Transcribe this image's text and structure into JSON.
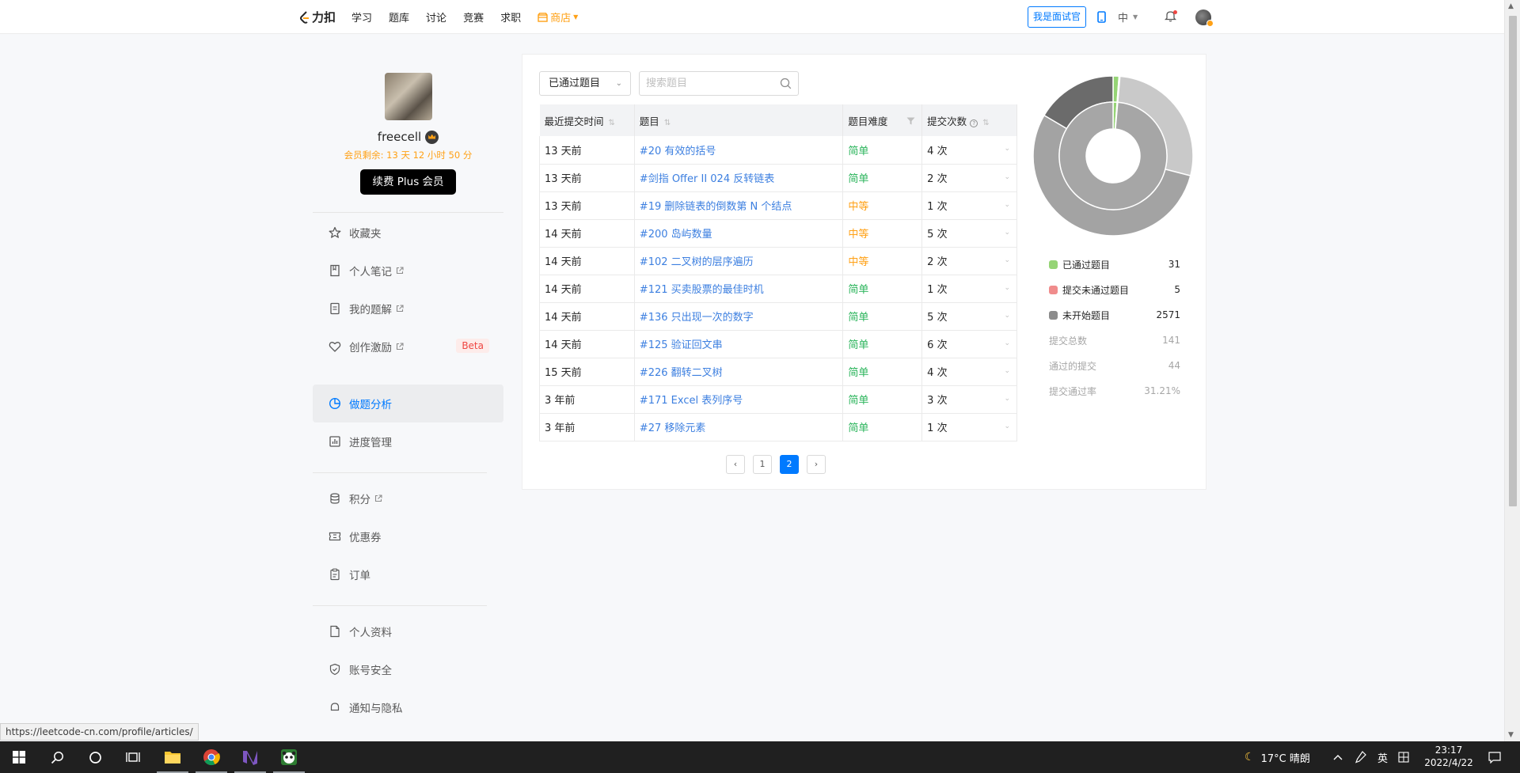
{
  "nav": {
    "logo_text": "力扣",
    "links": [
      "学习",
      "题库",
      "讨论",
      "竞赛",
      "求职"
    ],
    "store_label": "商店",
    "interviewer_button": "我是面试官",
    "lang_label": "中"
  },
  "profile": {
    "username": "freecell",
    "member_remaining": "会员剩余: 13 天 12 小时 50 分",
    "renew_button": "续费 Plus 会员"
  },
  "sidebar": {
    "group1": [
      {
        "label": "收藏夹",
        "icon": "star-icon"
      },
      {
        "label": "个人笔记",
        "icon": "notebook-icon",
        "external": true
      },
      {
        "label": "我的题解",
        "icon": "document-icon",
        "external": true
      },
      {
        "label": "创作激励",
        "icon": "heart-icon",
        "external": true,
        "badge": "Beta"
      }
    ],
    "group2": [
      {
        "label": "做题分析",
        "icon": "pie-chart-icon",
        "active": true
      },
      {
        "label": "进度管理",
        "icon": "bar-chart-icon"
      }
    ],
    "group3": [
      {
        "label": "积分",
        "icon": "coins-icon",
        "external": true
      },
      {
        "label": "优惠券",
        "icon": "coupon-icon"
      },
      {
        "label": "订单",
        "icon": "clipboard-icon"
      }
    ],
    "group4": [
      {
        "label": "个人资料",
        "icon": "file-icon"
      },
      {
        "label": "账号安全",
        "icon": "shield-icon"
      },
      {
        "label": "通知与隐私",
        "icon": "bell-icon"
      }
    ]
  },
  "filters": {
    "status_select": "已通过题目",
    "search_placeholder": "搜索题目"
  },
  "table": {
    "headers": [
      "最近提交时间",
      "题目",
      "题目难度",
      "提交次数"
    ],
    "rows": [
      {
        "time": "13 天前",
        "title": "#20 有效的括号",
        "difficulty": "简单",
        "level": "easy",
        "count": "4 次"
      },
      {
        "time": "13 天前",
        "title": "#剑指 Offer II 024 反转链表",
        "difficulty": "简单",
        "level": "easy",
        "count": "2 次"
      },
      {
        "time": "13 天前",
        "title": "#19 删除链表的倒数第 N 个结点",
        "difficulty": "中等",
        "level": "medium",
        "count": "1 次"
      },
      {
        "time": "14 天前",
        "title": "#200 岛屿数量",
        "difficulty": "中等",
        "level": "medium",
        "count": "5 次"
      },
      {
        "time": "14 天前",
        "title": "#102 二叉树的层序遍历",
        "difficulty": "中等",
        "level": "medium",
        "count": "2 次"
      },
      {
        "time": "14 天前",
        "title": "#121 买卖股票的最佳时机",
        "difficulty": "简单",
        "level": "easy",
        "count": "1 次"
      },
      {
        "time": "14 天前",
        "title": "#136 只出现一次的数字",
        "difficulty": "简单",
        "level": "easy",
        "count": "5 次"
      },
      {
        "time": "14 天前",
        "title": "#125 验证回文串",
        "difficulty": "简单",
        "level": "easy",
        "count": "6 次"
      },
      {
        "time": "15 天前",
        "title": "#226 翻转二叉树",
        "difficulty": "简单",
        "level": "easy",
        "count": "4 次"
      },
      {
        "time": "3 年前",
        "title": "#171 Excel 表列序号",
        "difficulty": "简单",
        "level": "easy",
        "count": "3 次"
      },
      {
        "time": "3 年前",
        "title": "#27 移除元素",
        "difficulty": "简单",
        "level": "easy",
        "count": "1 次"
      }
    ]
  },
  "pagination": {
    "pages": [
      "1",
      "2"
    ],
    "current": "2"
  },
  "stats": {
    "legend": [
      {
        "label": "已通过题目",
        "value": "31",
        "color": "#95d475"
      },
      {
        "label": "提交未通过题目",
        "value": "5",
        "color": "#f08c8c"
      },
      {
        "label": "未开始题目",
        "value": "2571",
        "color": "#8c8c8c"
      }
    ],
    "extra": [
      {
        "label": "提交总数",
        "value": "141"
      },
      {
        "label": "通过的提交",
        "value": "44"
      },
      {
        "label": "提交通过率",
        "value": "31.21%"
      }
    ],
    "inner_ring": [
      {
        "name": "已通过题目",
        "value": 31,
        "color": "#95d475"
      },
      {
        "name": "提交未通过题目",
        "value": 5,
        "color": "#f08c8c"
      },
      {
        "name": "未开始题目",
        "value": 2571,
        "color": "#a6a6a6"
      }
    ],
    "outer_ring": [
      {
        "value": 31,
        "color": "#95d475"
      },
      {
        "value": 5,
        "color": "#f08c8c"
      },
      {
        "value": 720,
        "color": "#c9c9c9"
      },
      {
        "value": 1420,
        "color": "#a3a3a3"
      },
      {
        "value": 431,
        "color": "#6b6b6b"
      }
    ]
  },
  "status_url": "https://leetcode-cn.com/profile/articles/",
  "taskbar": {
    "weather": "17°C  晴朗",
    "ime": "英",
    "time": "23:17",
    "date": "2022/4/22"
  }
}
